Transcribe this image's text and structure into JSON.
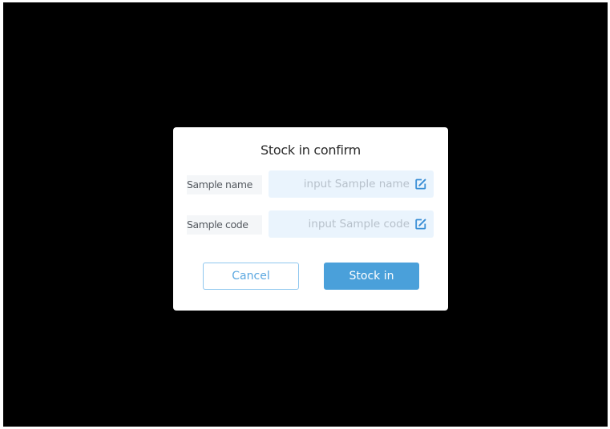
{
  "dialog": {
    "title": "Stock in confirm",
    "fields": [
      {
        "label": "Sample name",
        "value": "",
        "placeholder": "input Sample name",
        "icon": "edit-icon"
      },
      {
        "label": "Sample code",
        "value": "",
        "placeholder": "input Sample code",
        "icon": "edit-icon"
      }
    ],
    "cancel_label": "Cancel",
    "confirm_label": "Stock in"
  },
  "colors": {
    "backdrop": "#000000",
    "dialog_bg": "#ffffff",
    "input_bg": "#eaf4fd",
    "accent": "#4aa0da",
    "placeholder": "#b7c1cb"
  }
}
